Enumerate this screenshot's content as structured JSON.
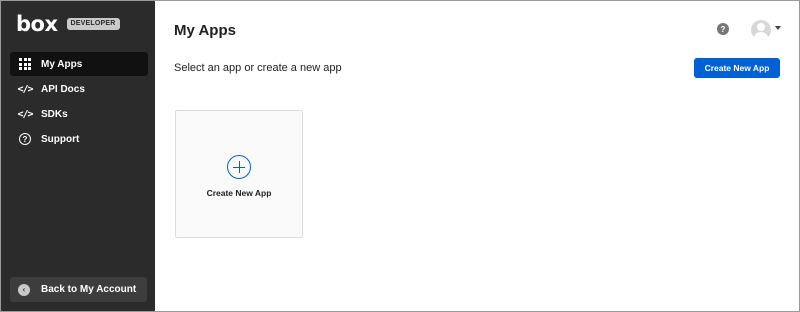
{
  "brand": {
    "logo_text": "box",
    "badge": "DEVELOPER"
  },
  "sidebar": {
    "items": [
      {
        "label": "My Apps",
        "icon": "grid-icon",
        "active": true
      },
      {
        "label": "API Docs",
        "icon": "code-icon",
        "active": false
      },
      {
        "label": "SDKs",
        "icon": "code-icon",
        "active": false
      },
      {
        "label": "Support",
        "icon": "help-circle-icon",
        "active": false
      }
    ],
    "back_label": "Back to My Account",
    "code_glyph": "</>",
    "help_glyph": "?",
    "back_glyph": "‹"
  },
  "header": {
    "title": "My Apps",
    "help_glyph": "?"
  },
  "main": {
    "subtitle": "Select an app or create a new app",
    "create_button": "Create New App",
    "card_label": "Create New App"
  },
  "colors": {
    "sidebar_bg": "#2b2b2b",
    "active_item_bg": "#111111",
    "primary": "#0061d5"
  }
}
